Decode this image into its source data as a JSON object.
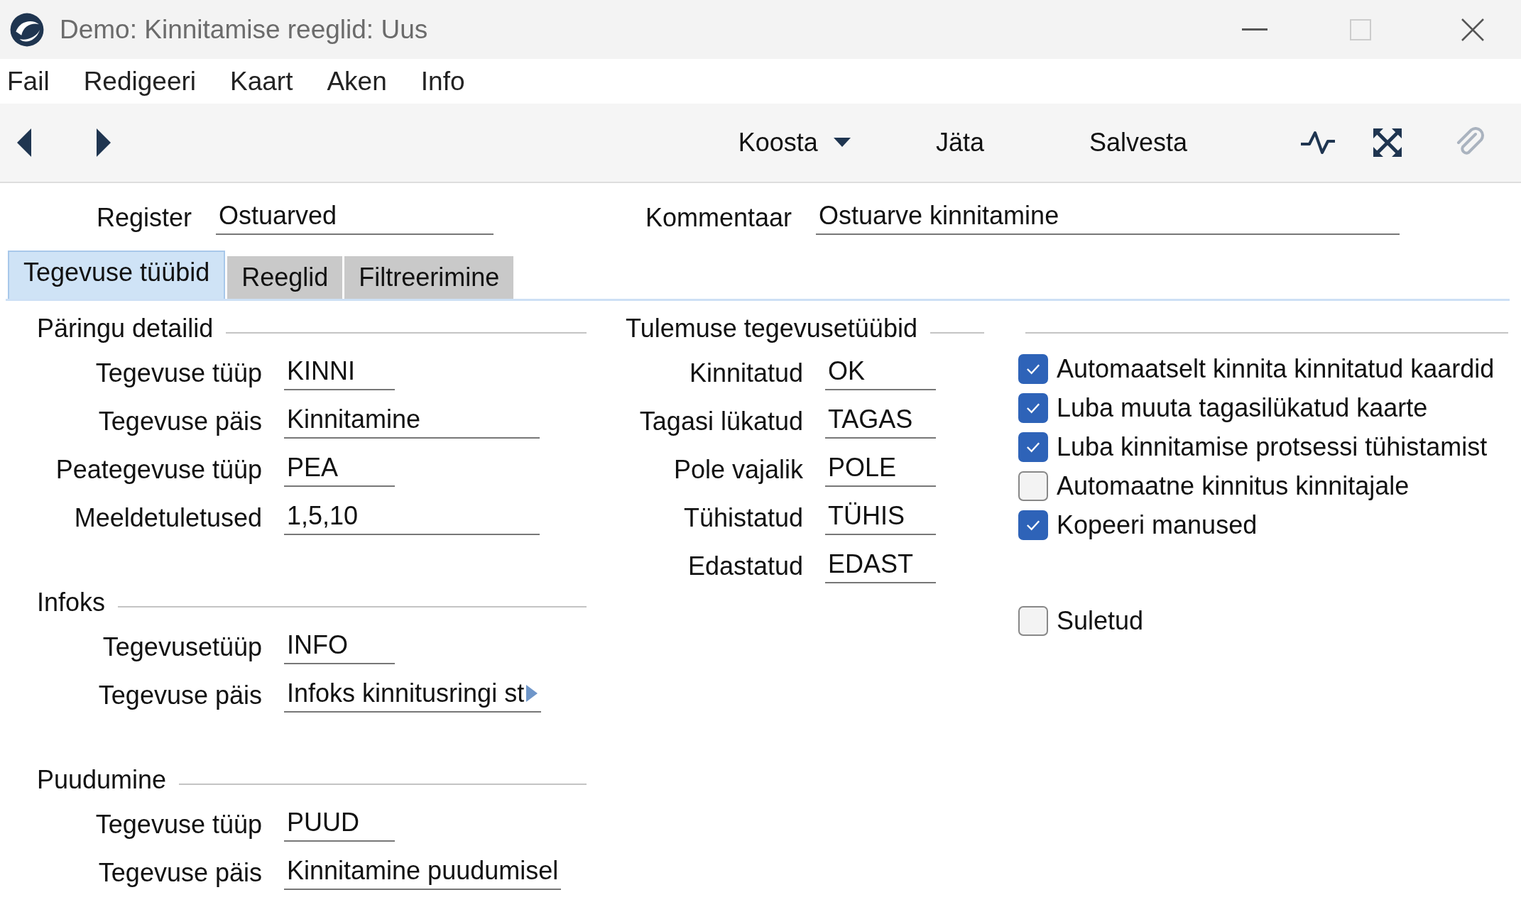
{
  "window": {
    "title": "Demo: Kinnitamise reeglid: Uus"
  },
  "menu": [
    "Fail",
    "Redigeeri",
    "Kaart",
    "Aken",
    "Info"
  ],
  "toolbar": [
    {
      "label": "Koosta",
      "dropdown": true
    },
    {
      "label": "Jäta",
      "dropdown": false
    },
    {
      "label": "Salvesta",
      "dropdown": false
    }
  ],
  "header": [
    {
      "label": "Register",
      "value": "Ostuarved"
    },
    {
      "label": "Kommentaar",
      "value": "Ostuarve kinnitamine"
    }
  ],
  "tabs": [
    {
      "label": "Tegevuse tüübid",
      "selected": true
    },
    {
      "label": "Reeglid",
      "selected": false
    },
    {
      "label": "Filtreerimine",
      "selected": false
    }
  ],
  "sections": [
    {
      "title": "Päringu detailid",
      "rows": [
        {
          "label": "Tegevuse tüüp",
          "value": "KINNI",
          "kind": "code"
        },
        {
          "label": "Tegevuse päis",
          "value": "Kinnitamine",
          "kind": "text"
        },
        {
          "label": "Peategevuse tüüp",
          "value": "PEA",
          "kind": "code"
        },
        {
          "label": "Meeldetuletused",
          "value": "1,5,10",
          "kind": "text"
        }
      ]
    },
    {
      "title": "Infoks",
      "rows": [
        {
          "label": "Tegevusetüüp",
          "value": "INFO",
          "kind": "code"
        },
        {
          "label": "Tegevuse päis",
          "value": "Infoks kinnitusringi st",
          "kind": "text",
          "overflow": true
        }
      ]
    },
    {
      "title": "Puudumine",
      "rows": [
        {
          "label": "Tegevuse tüüp",
          "value": "PUUD",
          "kind": "code"
        },
        {
          "label": "Tegevuse päis",
          "value": "Kinnitamine puudumisel",
          "kind": "text"
        }
      ]
    }
  ],
  "result_types": {
    "title": "Tulemuse tegevusetüübid",
    "rows": [
      {
        "label": "Kinnitatud",
        "value": "OK"
      },
      {
        "label": "Tagasi lükatud",
        "value": "TAGAS"
      },
      {
        "label": "Pole vajalik",
        "value": "POLE"
      },
      {
        "label": "Tühistatud",
        "value": "TÜHIS"
      },
      {
        "label": "Edastatud",
        "value": "EDAST"
      }
    ]
  },
  "options": [
    {
      "label": "Automaatselt kinnita kinnitatud kaardid",
      "checked": true
    },
    {
      "label": "Luba muuta tagasilükatud kaarte",
      "checked": true
    },
    {
      "label": "Luba kinnitamise protsessi tühistamist",
      "checked": true
    },
    {
      "label": "Automaatne kinnitus kinnitajale",
      "checked": false
    },
    {
      "label": "Kopeeri manused",
      "checked": true
    }
  ],
  "closed_option": {
    "label": "Suletud",
    "checked": false
  }
}
